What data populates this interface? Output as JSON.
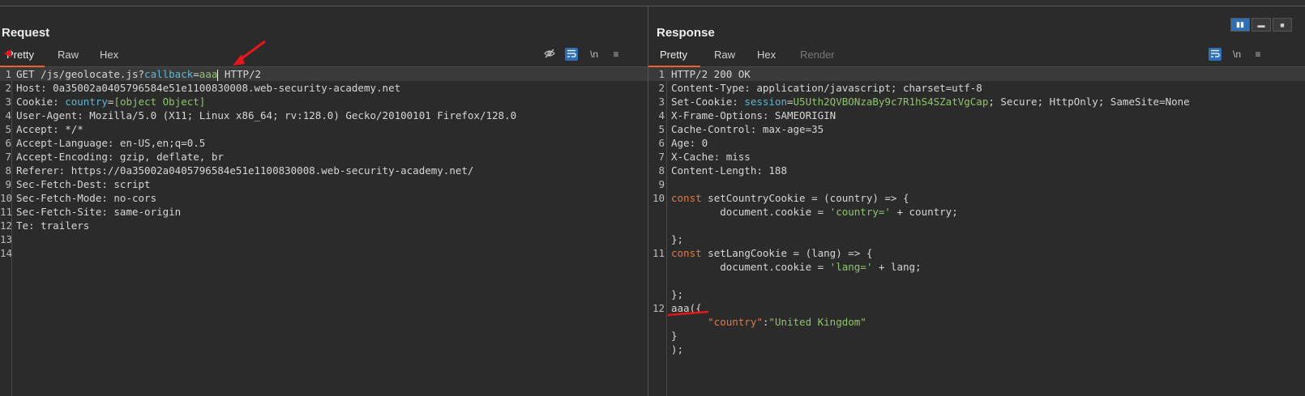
{
  "request": {
    "title": "Request",
    "tabs": [
      "Pretty",
      "Raw",
      "Hex"
    ],
    "active_tab": "Pretty",
    "tools": {
      "hide_icon": "eye-off-icon",
      "wrap_icon": "wrap-icon",
      "newline_label": "\\n",
      "menu_icon": "menu-icon"
    },
    "lines": [
      {
        "n": "1",
        "parts": [
          {
            "t": "GET /js/geolocate.js?"
          },
          {
            "t": "callback",
            "c": "cyan"
          },
          {
            "t": "="
          },
          {
            "t": "aaa",
            "c": "green"
          },
          {
            "cursor": true
          },
          {
            "t": " HTTP/2"
          }
        ]
      },
      {
        "n": "2",
        "parts": [
          {
            "t": "Host: 0a35002a0405796584e51e1100830008.web-security-academy.net"
          }
        ]
      },
      {
        "n": "3",
        "parts": [
          {
            "t": "Cookie: "
          },
          {
            "t": "country",
            "c": "cyan"
          },
          {
            "t": "="
          },
          {
            "t": "[object Object]",
            "c": "green"
          }
        ]
      },
      {
        "n": "4",
        "parts": [
          {
            "t": "User-Agent: Mozilla/5.0 (X11; Linux x86_64; rv:128.0) Gecko/20100101 Firefox/128.0"
          }
        ]
      },
      {
        "n": "5",
        "parts": [
          {
            "t": "Accept: */*"
          }
        ]
      },
      {
        "n": "6",
        "parts": [
          {
            "t": "Accept-Language: en-US,en;q=0.5"
          }
        ]
      },
      {
        "n": "7",
        "parts": [
          {
            "t": "Accept-Encoding: gzip, deflate, br"
          }
        ]
      },
      {
        "n": "8",
        "parts": [
          {
            "t": "Referer: https://0a35002a0405796584e51e1100830008.web-security-academy.net/"
          }
        ]
      },
      {
        "n": "9",
        "parts": [
          {
            "t": "Sec-Fetch-Dest: script"
          }
        ]
      },
      {
        "n": "10",
        "parts": [
          {
            "t": "Sec-Fetch-Mode: no-cors"
          }
        ]
      },
      {
        "n": "11",
        "parts": [
          {
            "t": "Sec-Fetch-Site: same-origin"
          }
        ]
      },
      {
        "n": "12",
        "parts": [
          {
            "t": "Te: trailers"
          }
        ]
      },
      {
        "n": "13",
        "parts": []
      },
      {
        "n": "14",
        "parts": []
      }
    ]
  },
  "response": {
    "title": "Response",
    "tabs": [
      "Pretty",
      "Raw",
      "Hex",
      "Render"
    ],
    "active_tab": "Pretty",
    "tools": {
      "wrap_icon": "wrap-icon",
      "newline_label": "\\n",
      "menu_icon": "menu-icon"
    },
    "lines": [
      {
        "n": "1",
        "parts": [
          {
            "t": "HTTP/2 200 OK"
          }
        ]
      },
      {
        "n": "2",
        "parts": [
          {
            "t": "Content-Type: application/javascript; charset=utf-8"
          }
        ]
      },
      {
        "n": "3",
        "parts": [
          {
            "t": "Set-Cookie: "
          },
          {
            "t": "session",
            "c": "cyan"
          },
          {
            "t": "="
          },
          {
            "t": "U5Uth2QVBONzaBy9c7R1hS4SZatVgCap",
            "c": "green"
          },
          {
            "t": "; Secure; HttpOnly; SameSite=None"
          }
        ]
      },
      {
        "n": "4",
        "parts": [
          {
            "t": "X-Frame-Options: SAMEORIGIN"
          }
        ]
      },
      {
        "n": "5",
        "parts": [
          {
            "t": "Cache-Control: max-age=35"
          }
        ]
      },
      {
        "n": "6",
        "parts": [
          {
            "t": "Age: 0"
          }
        ]
      },
      {
        "n": "7",
        "parts": [
          {
            "t": "X-Cache: miss"
          }
        ]
      },
      {
        "n": "8",
        "parts": [
          {
            "t": "Content-Length: 188"
          }
        ]
      },
      {
        "n": "9",
        "parts": []
      },
      {
        "n": "10",
        "parts": [
          {
            "t": "const",
            "c": "orange"
          },
          {
            "t": " setCountryCookie = (country) => {"
          }
        ]
      },
      {
        "n": "",
        "parts": [
          {
            "t": "        document.cookie = "
          },
          {
            "t": "'country='",
            "c": "green"
          },
          {
            "t": " + country;"
          }
        ]
      },
      {
        "n": "",
        "parts": []
      },
      {
        "n": "",
        "parts": [
          {
            "t": "};"
          }
        ]
      },
      {
        "n": "11",
        "parts": [
          {
            "t": "const",
            "c": "orange"
          },
          {
            "t": " setLangCookie = (lang) => {"
          }
        ]
      },
      {
        "n": "",
        "parts": [
          {
            "t": "        document.cookie = "
          },
          {
            "t": "'lang='",
            "c": "green"
          },
          {
            "t": " + lang;"
          }
        ]
      },
      {
        "n": "",
        "parts": []
      },
      {
        "n": "",
        "parts": [
          {
            "t": "};"
          }
        ]
      },
      {
        "n": "12",
        "parts": [
          {
            "t": "aaa({"
          }
        ]
      },
      {
        "n": "",
        "parts": [
          {
            "t": "      "
          },
          {
            "t": "\"country\"",
            "c": "orange"
          },
          {
            "t": ":"
          },
          {
            "t": "\"United Kingdom\"",
            "c": "green"
          }
        ]
      },
      {
        "n": "",
        "parts": [
          {
            "t": "}"
          }
        ]
      },
      {
        "n": "",
        "parts": [
          {
            "t": ");"
          }
        ]
      }
    ]
  },
  "layout_buttons": [
    "split-horizontal-icon",
    "split-vertical-icon",
    "single-pane-icon"
  ],
  "colors": {
    "accent": "#e8642c",
    "key": "#5ab8d0",
    "value": "#8fc46b",
    "keyword": "#e07b45",
    "annotation": "#e8151b"
  }
}
